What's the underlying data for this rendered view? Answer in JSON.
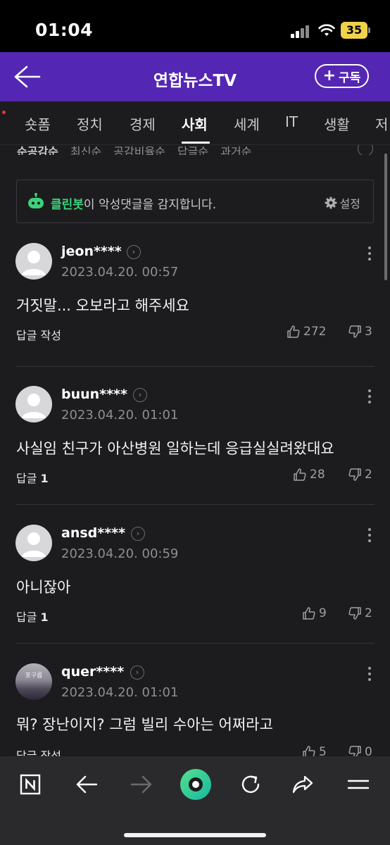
{
  "status_bar": {
    "time": "01:04",
    "battery": "35"
  },
  "header": {
    "title": "연합뉴스TV",
    "subscribe_label": "구독"
  },
  "tabs": [
    "숏폼",
    "정치",
    "경제",
    "사회",
    "세계",
    "IT",
    "생활",
    "저"
  ],
  "active_tab": "사회",
  "sort_options": [
    "순공감순",
    "최신순",
    "공감비율순",
    "답글순",
    "과거순"
  ],
  "cleanbot": {
    "name": "클린봇",
    "message": "이 악성댓글을 감지합니다.",
    "settings_label": "설정"
  },
  "comments": [
    {
      "user": "jeon****",
      "date": "2023.04.20. 00:57",
      "text": "거짓말... 오보라고 해주세요",
      "reply": "답글 작성",
      "reply_count": "",
      "likes": "272",
      "dislikes": "3"
    },
    {
      "user": "buun****",
      "date": "2023.04.20. 01:01",
      "text": "사실임 친구가 아산병원 일하는데 응급실실려왔대요",
      "reply": "답글",
      "reply_count": "1",
      "likes": "28",
      "dislikes": "2"
    },
    {
      "user": "ansd****",
      "date": "2023.04.20. 00:59",
      "text": "아니잖아",
      "reply": "답글",
      "reply_count": "1",
      "likes": "9",
      "dislikes": "2"
    },
    {
      "user": "quer****",
      "date": "2023.04.20. 01:01",
      "text": "뭐? 장난이지? 그럼 빌리 수아는 어쩌라고",
      "reply": "답글 작성",
      "reply_count": "",
      "likes": "5",
      "dislikes": "0",
      "avatar_text": "포구름"
    }
  ],
  "colors": {
    "header": "#5426b4",
    "background": "#1c1c1e",
    "cleanbot_accent": "#3dd27a",
    "player": "#2fd08a"
  },
  "toolbar_icons": [
    "naver-n-icon",
    "back-arrow-icon",
    "forward-arrow-icon",
    "player-icon",
    "refresh-icon",
    "share-icon",
    "menu-icon"
  ]
}
